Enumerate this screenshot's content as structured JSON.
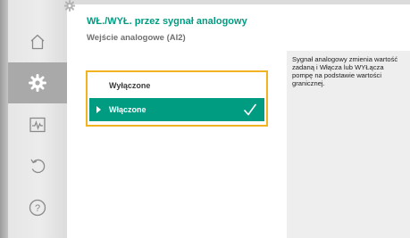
{
  "header": {
    "title": "WŁ./WYŁ. przez sygnał analogowy",
    "subtitle": "Wejście analogowe (AI2)"
  },
  "nav": {
    "items": [
      {
        "icon": "home-icon",
        "active": false
      },
      {
        "icon": "gear-icon",
        "active": true
      },
      {
        "icon": "diagnostics-icon",
        "active": false
      },
      {
        "icon": "restore-icon",
        "active": false
      },
      {
        "icon": "help-icon",
        "active": false
      }
    ]
  },
  "options": [
    {
      "label": "Wyłączone",
      "selected": false
    },
    {
      "label": "Włączone",
      "selected": true
    }
  ],
  "help": {
    "text": "Sygnał analogowy zmienia wartość zadaną i Włącza lub WYŁącza pompę na podstawie wartości granicznej."
  },
  "colors": {
    "accent": "#009c82",
    "focus": "#f2b321",
    "nav_active": "#a9a9a9"
  }
}
